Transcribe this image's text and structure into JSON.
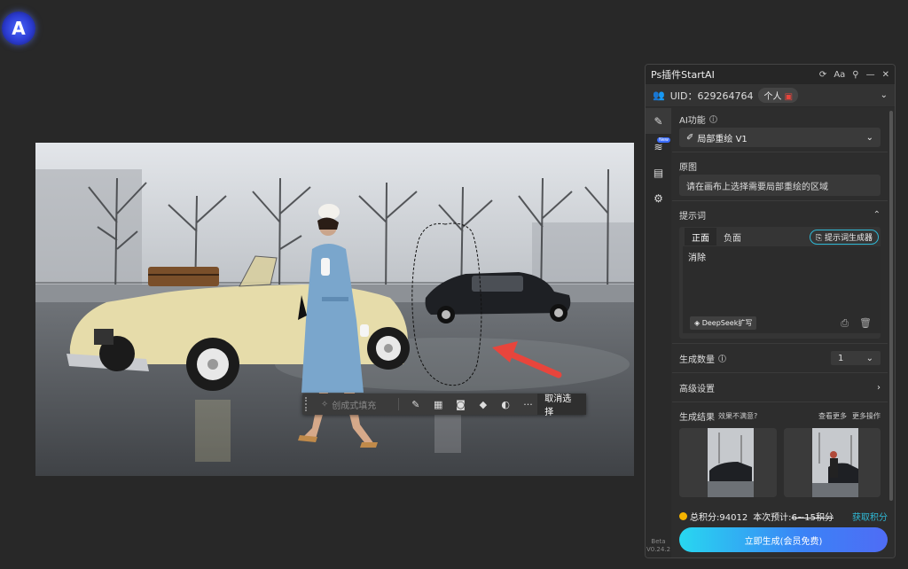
{
  "app": {
    "logo_letter": "A"
  },
  "canvas_toolbar": {
    "fill_label": "创成式填充",
    "cancel_label": "取消选择",
    "more_label": "···"
  },
  "panel": {
    "title": "Ps插件StartAI",
    "title_buttons": {
      "refresh": "⟳",
      "font": "Aa",
      "pin": "📌",
      "minimize": "—",
      "close": "✕"
    },
    "uid_text": "UID：629264764",
    "account_badge": "个人",
    "rail": {
      "new_tag": "New",
      "beta": "Beta",
      "version": "V0.24.2"
    },
    "ai_function": {
      "label": "AI功能",
      "value": "局部重绘 V1"
    },
    "original": {
      "label": "原图",
      "hint": "请在画布上选择需要局部重绘的区域"
    },
    "prompt": {
      "label": "提示词",
      "tab_positive": "正面",
      "tab_negative": "负面",
      "generator_btn": "提示词生成器",
      "text": "消除",
      "deepseek_btn": "DeepSeek扩写"
    },
    "quantity": {
      "label": "生成数量",
      "value": "1"
    },
    "advanced": {
      "label": "高级设置"
    },
    "results": {
      "label": "生成结果",
      "unsatisfied": "效果不满意?",
      "view_more": "查看更多",
      "more_ops": "更多操作"
    },
    "footer": {
      "total_points": "总积分:94012",
      "estimate_label": "本次预计:",
      "estimate_value": "6~15积分",
      "get_points": "获取积分",
      "generate_btn": "立即生成(会员免费)"
    }
  },
  "colors": {
    "accent": "#2fb9d6",
    "arrow": "#e8453c",
    "coin": "#f5b400"
  }
}
